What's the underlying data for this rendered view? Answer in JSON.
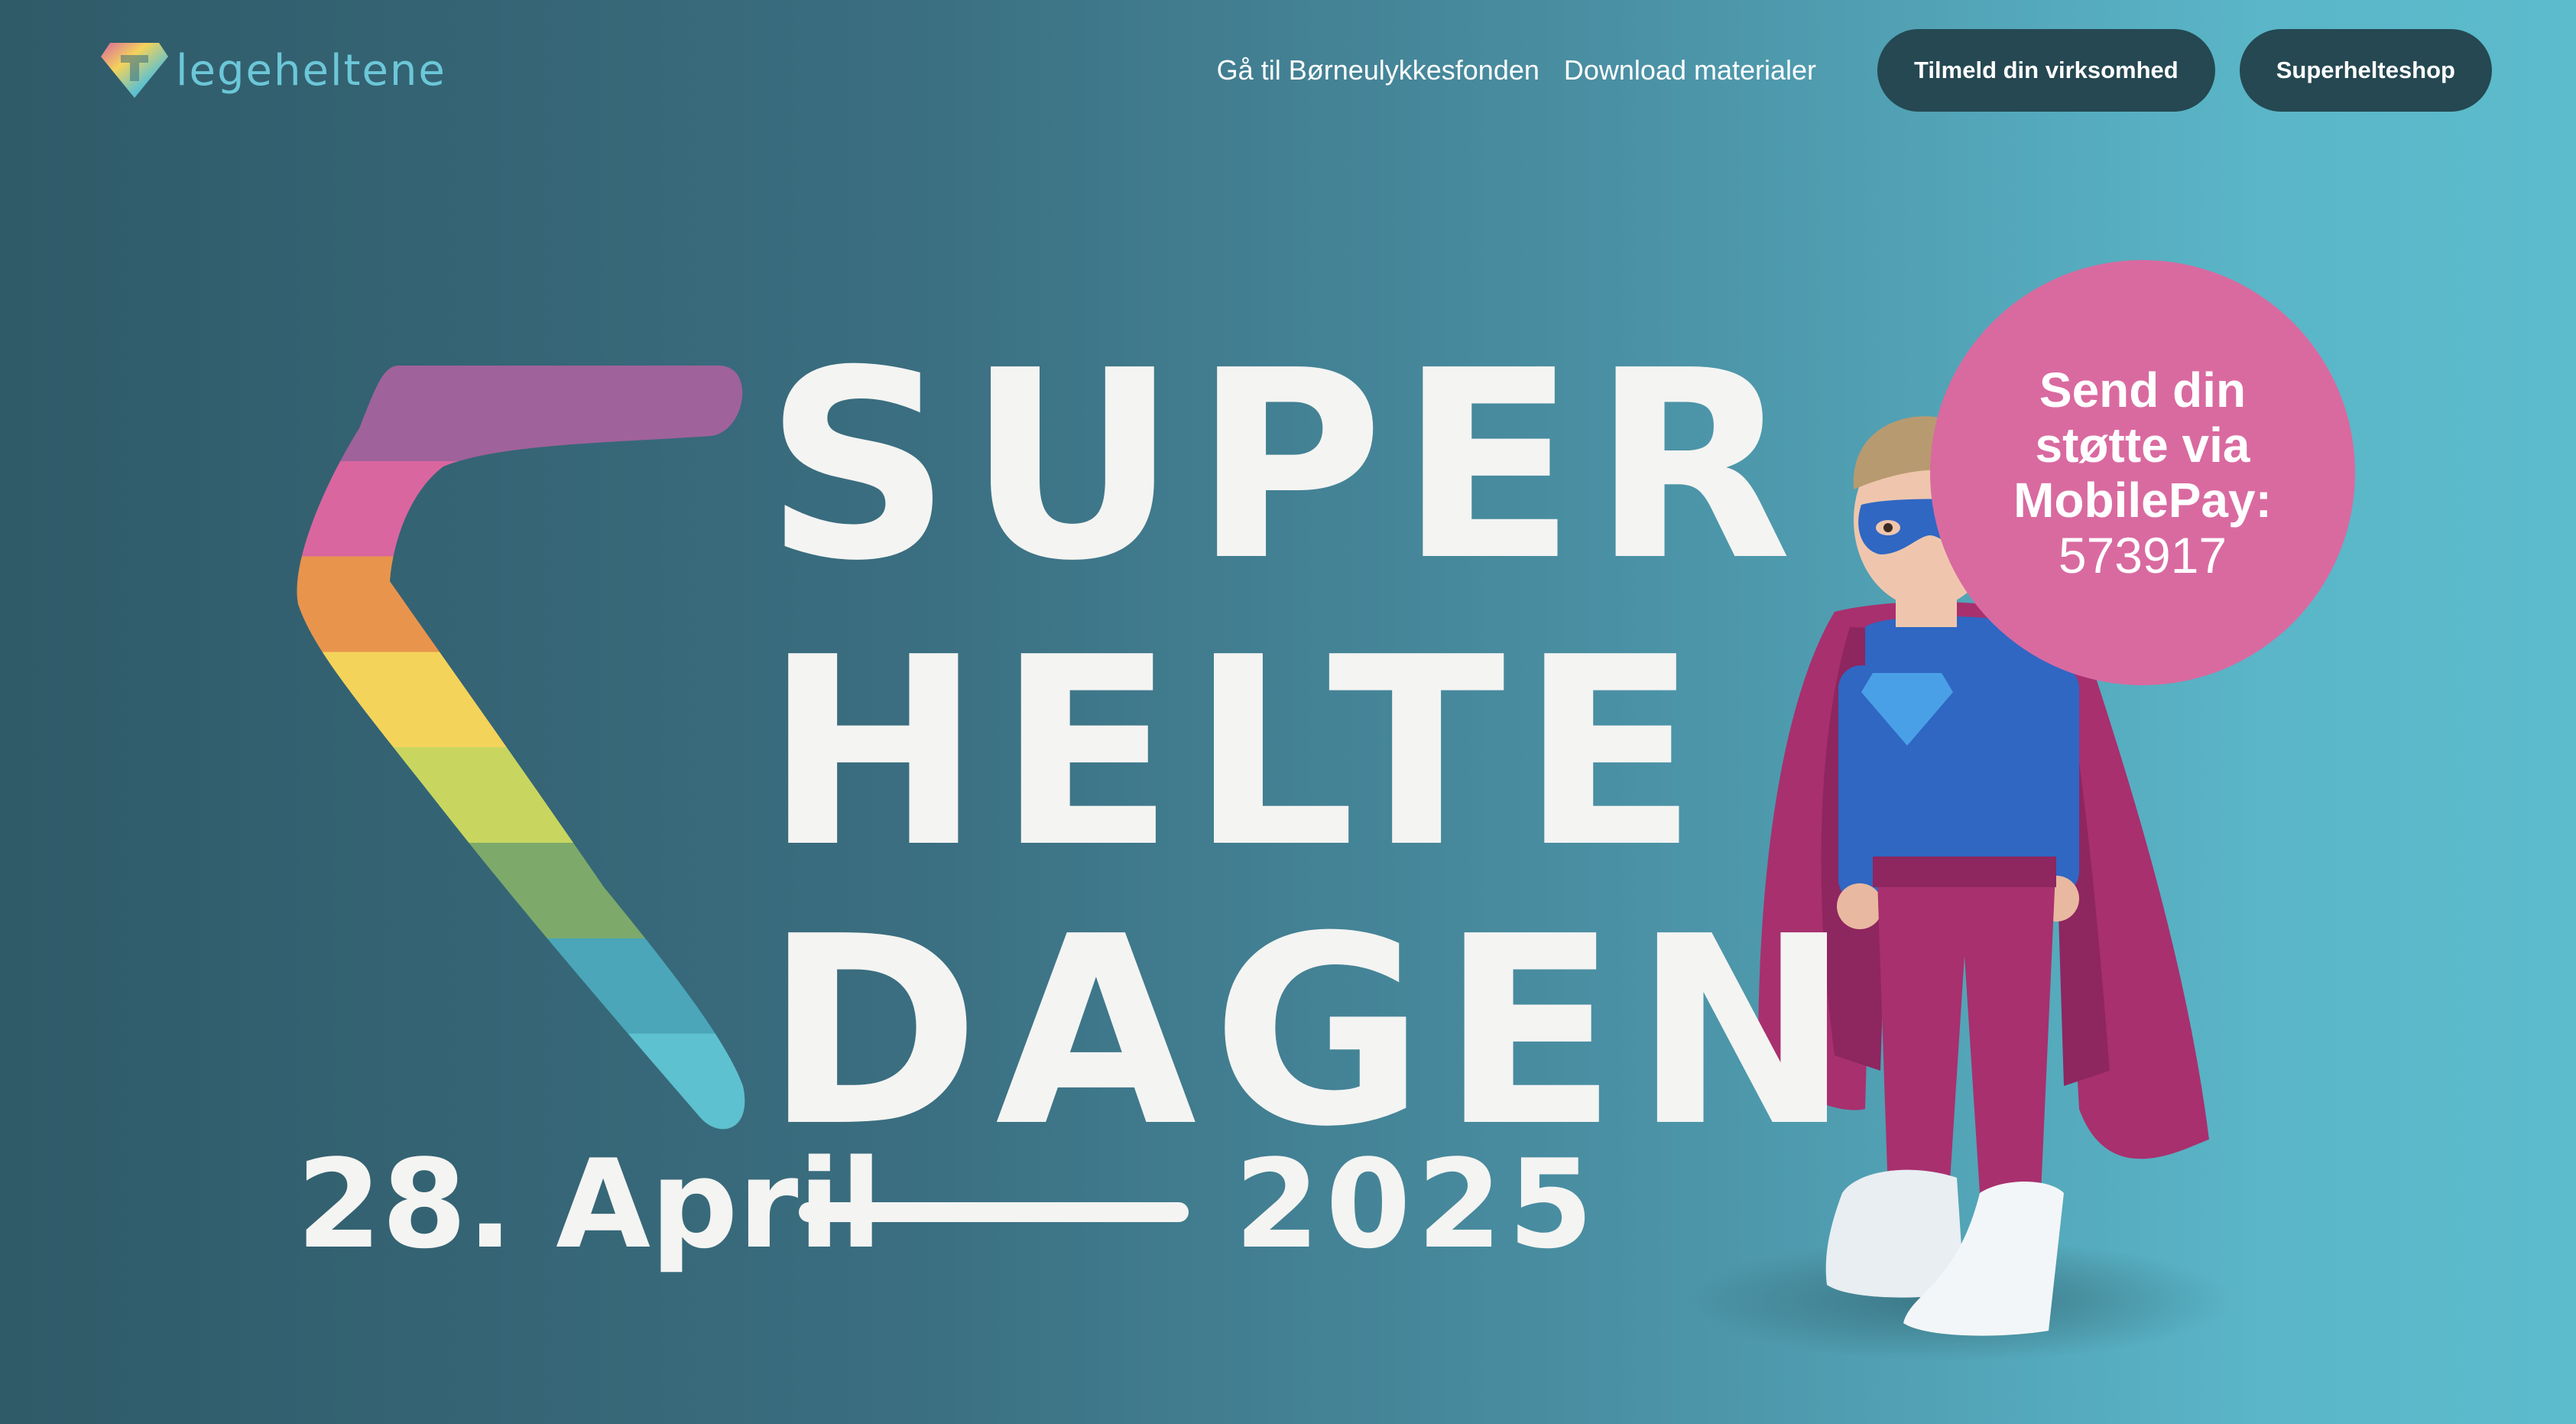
{
  "header": {
    "logo_text": "legeheltene",
    "nav_links": [
      "Gå til Børneulykkesfonden",
      "Download materialer"
    ],
    "buttons": [
      "Tilmeld din virksomhed",
      "Superhelteshop"
    ]
  },
  "hero": {
    "title_lines": [
      "SUPER",
      "HELTE",
      "DAGEN"
    ],
    "date_left": "28. April",
    "date_right": "2025",
    "bubble": {
      "lines": [
        "Send din",
        "støtte via",
        "MobilePay:"
      ],
      "number": "573917"
    }
  },
  "colors": {
    "button_bg": "#254852",
    "bubble_bg": "#d96aa0",
    "rainbow": [
      "#a0629a",
      "#d9669f",
      "#e8944d",
      "#f4d35a",
      "#c8d660",
      "#7daa6a",
      "#4aa6b8",
      "#5ec1cf"
    ]
  }
}
